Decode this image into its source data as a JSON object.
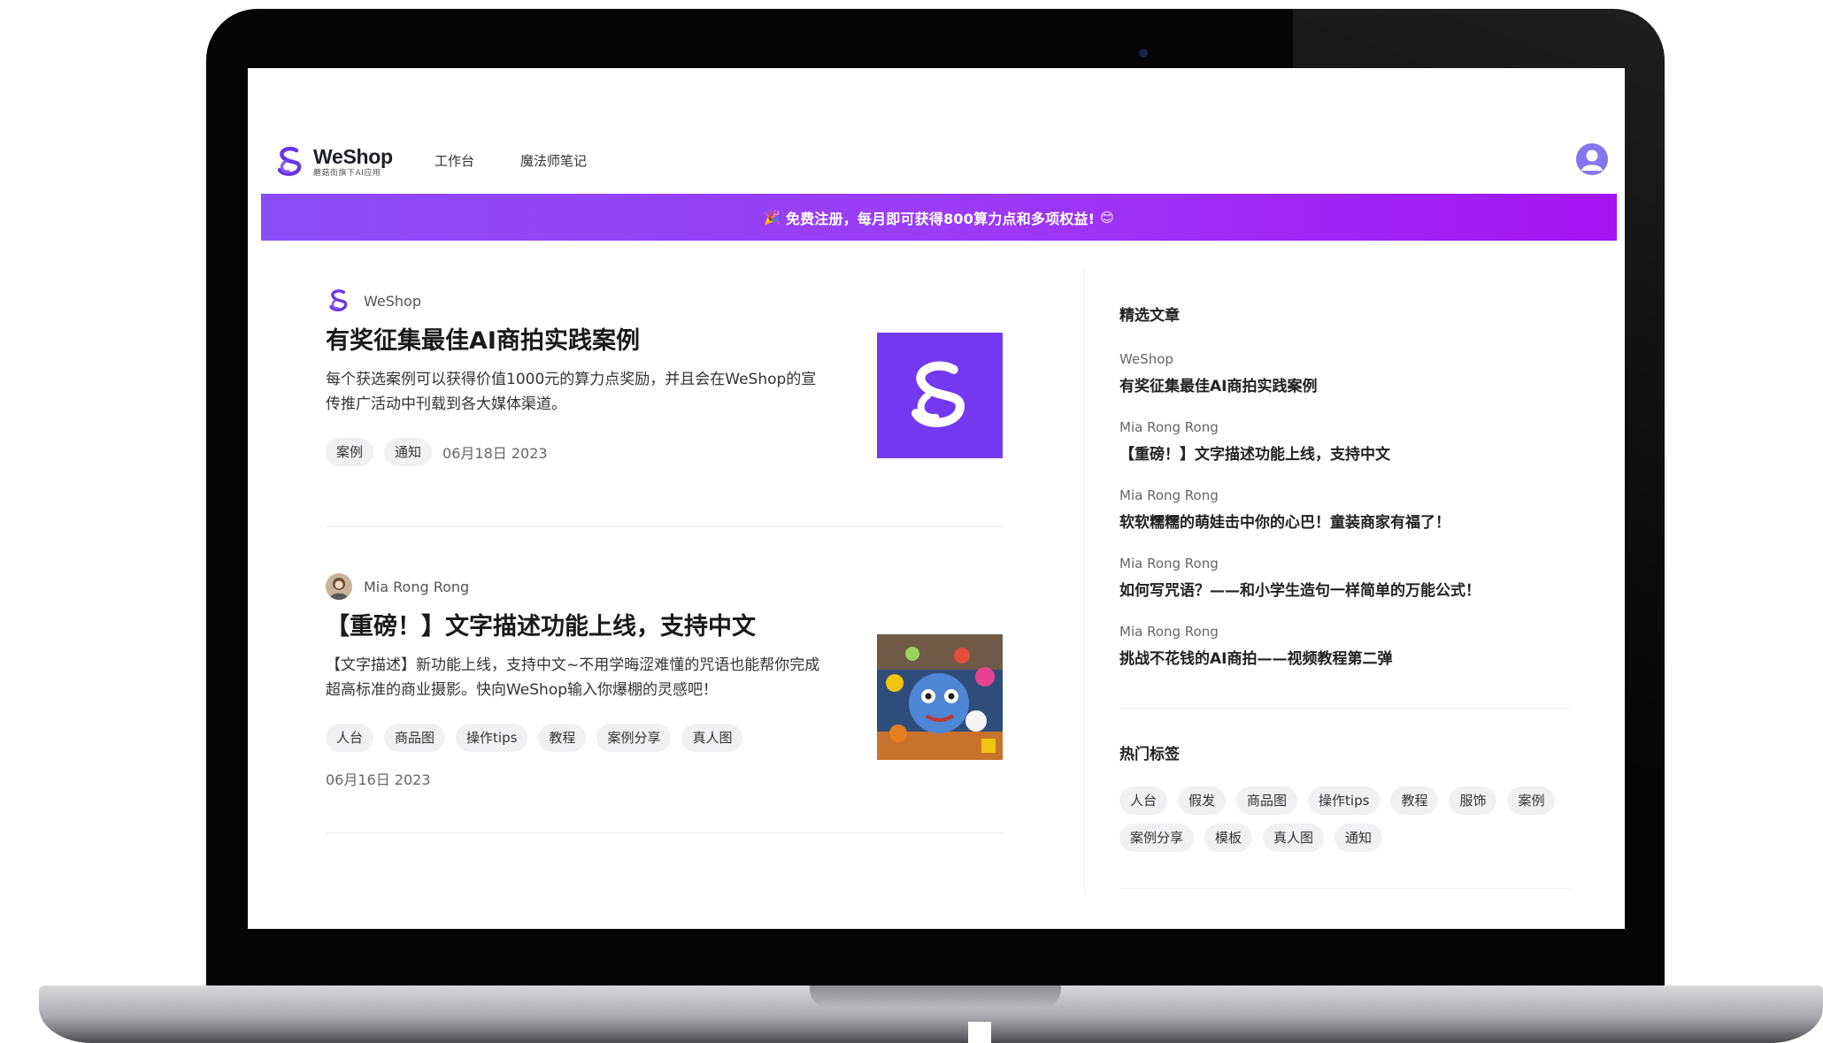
{
  "nav": {
    "logo_name": "WeShop",
    "logo_sub": "蘑菇街旗下AI应用",
    "links": [
      "工作台",
      "魔法师笔记"
    ]
  },
  "banner": {
    "text": "免费注册，每月即可获得800算力点和多项权益!",
    "emoji_left": "🎉",
    "emoji_right": "😊"
  },
  "articles": [
    {
      "author": "WeShop",
      "title": "有奖征集最佳AI商拍实践案例",
      "desc": "每个获选案例可以获得价值1000元的算力点奖励，并且会在WeShop的宣传推广活动中刊载到各大媒体渠道。",
      "tags": [
        "案例",
        "通知"
      ],
      "date": "06月18日 2023"
    },
    {
      "author": "Mia Rong Rong",
      "title": "【重磅！】文字描述功能上线，支持中文",
      "desc": "【文字描述】新功能上线，支持中文~不用学晦涩难懂的咒语也能帮你完成超高标准的商业摄影。快向WeShop输入你爆棚的灵感吧！",
      "tags": [
        "人台",
        "商品图",
        "操作tips",
        "教程",
        "案例分享",
        "真人图"
      ],
      "date": "06月16日 2023"
    }
  ],
  "sidebar": {
    "featured_title": "精选文章",
    "featured": [
      {
        "author": "WeShop",
        "title": "有奖征集最佳AI商拍实践案例"
      },
      {
        "author": "Mia Rong Rong",
        "title": "【重磅！】文字描述功能上线，支持中文"
      },
      {
        "author": "Mia Rong Rong",
        "title": "软软糯糯的萌娃击中你的心巴！童装商家有福了！"
      },
      {
        "author": "Mia Rong Rong",
        "title": "如何写咒语？——和小学生造句一样简单的万能公式！"
      },
      {
        "author": "Mia Rong Rong",
        "title": "挑战不花钱的AI商拍——视频教程第二弹"
      }
    ],
    "tags_title": "热门标签",
    "tags": [
      "人台",
      "假发",
      "商品图",
      "操作tips",
      "教程",
      "服饰",
      "案例",
      "案例分享",
      "模板",
      "真人图",
      "通知"
    ]
  },
  "colors": {
    "brand": "#7339f0",
    "banner_start": "#8a4cf7",
    "banner_end": "#a414f3"
  }
}
